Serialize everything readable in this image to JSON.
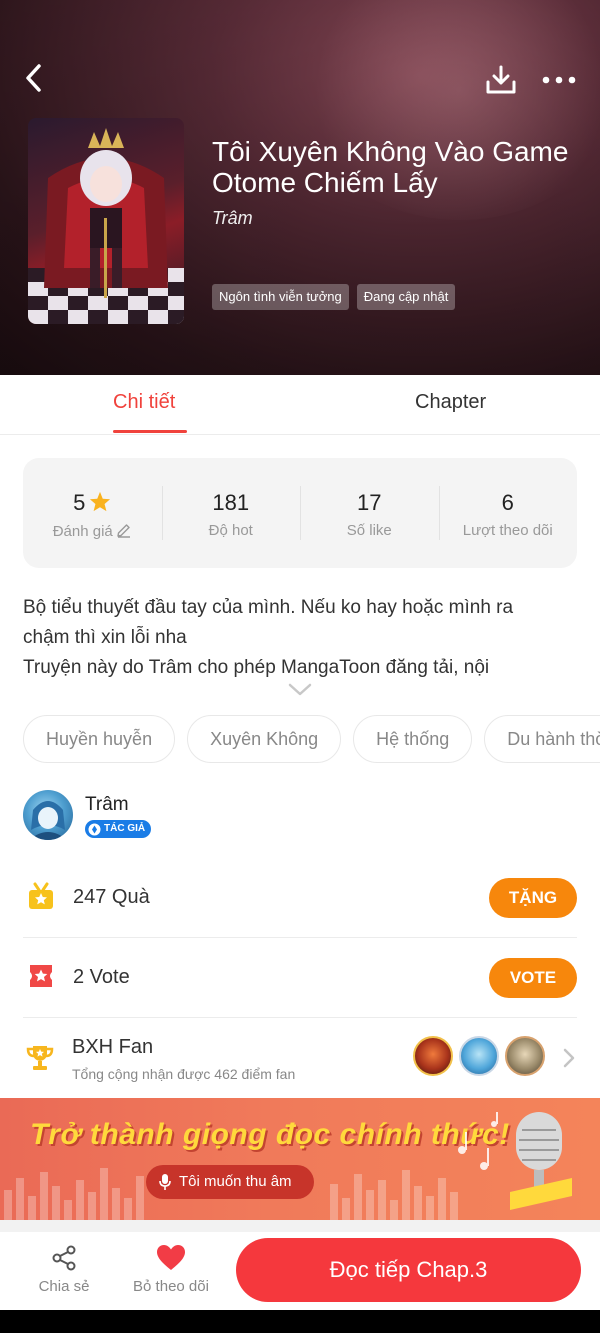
{
  "header": {
    "title": "Tôi Xuyên Không Vào Game Otome Chiếm Lấy",
    "author": "Trâm",
    "tags": [
      "Ngôn tình viễn tưởng",
      "Đang cập nhật"
    ],
    "icons": {
      "back": "back-arrow-icon",
      "download": "download-icon",
      "more": "more-icon"
    }
  },
  "tabs": {
    "details": "Chi tiết",
    "chapters": "Chapter",
    "active": "Chi tiết"
  },
  "stats": {
    "rating": {
      "value": "5",
      "label": "Đánh giá"
    },
    "hot": {
      "value": "181",
      "label": "Độ hot"
    },
    "likes": {
      "value": "17",
      "label": "Số like"
    },
    "followers": {
      "value": "6",
      "label": "Lượt theo dõi"
    }
  },
  "description": {
    "line1": "Bộ tiểu thuyết đầu tay của mình. Nếu ko hay hoặc mình ra",
    "line2": "chậm thì xin lỗi nha",
    "line3": "Truyện này do Trâm cho phép MangaToon đăng tải, nội"
  },
  "genres": [
    "Huyền huyễn",
    "Xuyên Không",
    "Hệ thống",
    "Du hành thời"
  ],
  "author_card": {
    "name": "Trâm",
    "badge": "TÁC GIẢ"
  },
  "gifts": {
    "count_text": "247 Quà",
    "button": "TẶNG"
  },
  "votes": {
    "count_text": "2 Vote",
    "button": "VOTE"
  },
  "fan_ranking": {
    "title": "BXH Fan",
    "subtitle": "Tổng cộng nhận được 462 điểm fan"
  },
  "banner": {
    "title": "Trở thành giọng đọc chính thức!",
    "button": "Tôi muốn thu âm"
  },
  "bottom_bar": {
    "share": "Chia sẻ",
    "unfollow": "Bỏ theo dõi",
    "read": "Đọc tiếp Chap.3"
  },
  "colors": {
    "accent": "#f0423c",
    "orange": "#f7870c",
    "read_button": "#f5383d",
    "banner": "#f07a5a"
  }
}
